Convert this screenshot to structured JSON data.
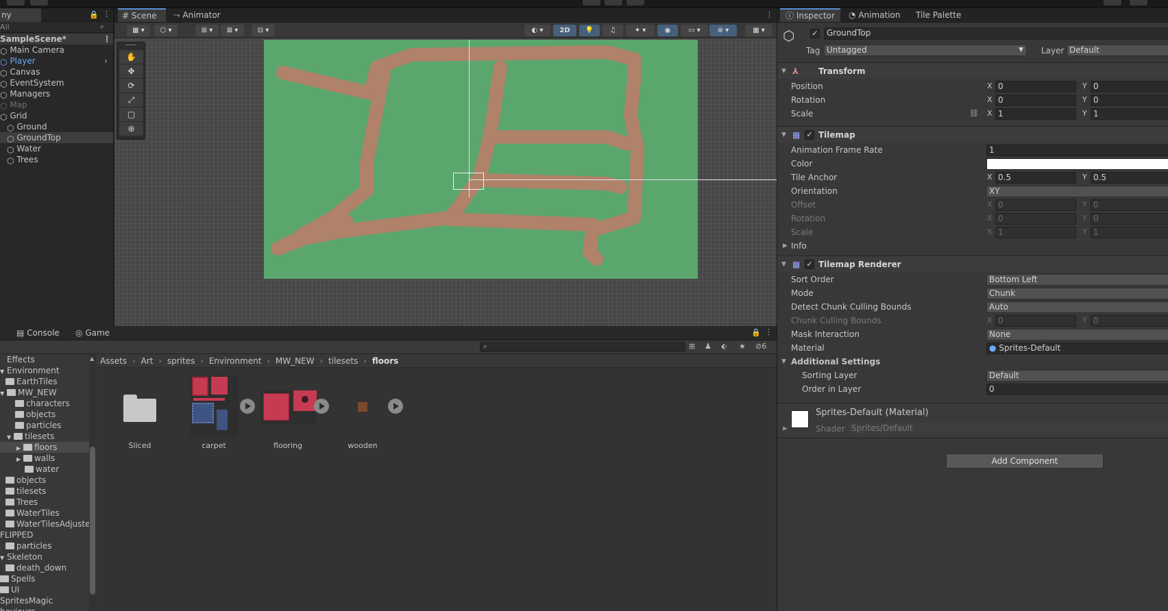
{
  "hierarchy": {
    "tab_label": "ny",
    "search_placeholder": "All",
    "scene_name": "SampleScene*",
    "items": [
      "Main Camera",
      "Player",
      "Canvas",
      "EventSystem",
      "Managers",
      "Map",
      "Grid",
      "Ground",
      "GroundTop",
      "Water",
      "Trees"
    ]
  },
  "scene": {
    "tabs": [
      "Scene",
      "Animator"
    ],
    "toolbar_2d": "2D"
  },
  "inspector": {
    "tabs": [
      "Inspector",
      "Animation",
      "Tile Palette"
    ],
    "object_name": "GroundTop",
    "tag_label": "Tag",
    "tag_value": "Untagged",
    "layer_label": "Layer",
    "layer_value": "Default",
    "transform": {
      "title": "Transform",
      "position_label": "Position",
      "position_x": "0",
      "position_y": "0",
      "rotation_label": "Rotation",
      "rotation_x": "0",
      "rotation_y": "0",
      "scale_label": "Scale",
      "scale_x": "1",
      "scale_y": "1"
    },
    "tilemap": {
      "title": "Tilemap",
      "frame_rate_label": "Animation Frame Rate",
      "frame_rate": "1",
      "color_label": "Color",
      "anchor_label": "Tile Anchor",
      "anchor_x": "0.5",
      "anchor_y": "0.5",
      "orientation_label": "Orientation",
      "orientation": "XY",
      "offset_label": "Offset",
      "offset_x": "0",
      "offset_y": "0",
      "rotation_label": "Rotation",
      "rotation_x": "0",
      "rotation_y": "0",
      "scale_label": "Scale",
      "scale_x": "1",
      "scale_y": "1",
      "info_label": "Info"
    },
    "renderer": {
      "title": "Tilemap Renderer",
      "sort_order_label": "Sort Order",
      "sort_order": "Bottom Left",
      "mode_label": "Mode",
      "mode": "Chunk",
      "detect_label": "Detect Chunk Culling Bounds",
      "detect": "Auto",
      "chunk_bounds_label": "Chunk Culling Bounds",
      "chunk_x": "0",
      "chunk_y": "0",
      "mask_label": "Mask Interaction",
      "mask": "None",
      "material_label": "Material",
      "material": "Sprites-Default",
      "additional_label": "Additional Settings",
      "sorting_layer_label": "Sorting Layer",
      "sorting_layer": "Default",
      "order_label": "Order in Layer",
      "order": "0"
    },
    "material_block": {
      "title": "Sprites-Default (Material)",
      "shader_label": "Shader",
      "shader": "Sprites/Default"
    },
    "add_component": "Add Component"
  },
  "bottom": {
    "tabs": [
      "Console",
      "Game"
    ],
    "hidden_count": "6",
    "breadcrumb": [
      "Assets",
      "Art",
      "sprites",
      "Environment",
      "MW_NEW",
      "tilesets",
      "floors"
    ],
    "tree": [
      "Effects",
      "Environment",
      "EarthTiles",
      "MW_NEW",
      "characters",
      "objects",
      "particles",
      "tilesets",
      "floors",
      "walls",
      "water",
      "objects",
      "tilesets",
      "Trees",
      "WaterTiles",
      "WaterTilesAdjuste",
      "FLIPPED",
      "particles",
      "Skeleton",
      "death_down",
      "Spells",
      "UI",
      "SpritesMagic",
      "haviours"
    ],
    "assets": [
      "Sliced",
      "carpet",
      "flooring",
      "wooden"
    ]
  }
}
